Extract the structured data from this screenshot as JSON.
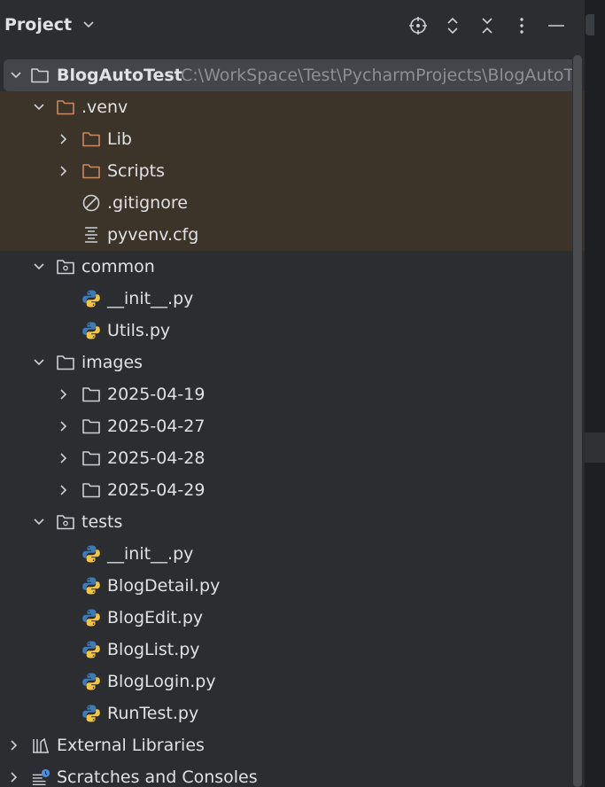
{
  "header": {
    "title": "Project",
    "buttons": [
      "locate-icon",
      "expand-all-icon",
      "collapse-all-icon",
      "more-icon",
      "minimize-icon"
    ]
  },
  "tree": {
    "root": {
      "label": "BlogAutoTest",
      "path": "C:\\WorkSpace\\Test\\PycharmProjects\\BlogAutoTest"
    },
    "venv": {
      "label": ".venv"
    },
    "lib": {
      "label": "Lib"
    },
    "scripts": {
      "label": "Scripts"
    },
    "gitignore": {
      "label": ".gitignore"
    },
    "pyvenv": {
      "label": "pyvenv.cfg"
    },
    "common": {
      "label": "common"
    },
    "common_init": {
      "label": "__init__.py"
    },
    "utils": {
      "label": "Utils.py"
    },
    "images": {
      "label": "images"
    },
    "img_dirs": [
      "2025-04-19",
      "2025-04-27",
      "2025-04-28",
      "2025-04-29"
    ],
    "tests": {
      "label": "tests"
    },
    "test_files": [
      "__init__.py",
      "BlogDetail.py",
      "BlogEdit.py",
      "BlogList.py",
      "BlogLogin.py",
      "RunTest.py"
    ],
    "external_libraries": {
      "label": "External Libraries"
    },
    "scratches": {
      "label": "Scratches and Consoles"
    }
  },
  "colors": {
    "background": "#2b2d30",
    "excluded_highlight": "#3d3429",
    "selected_row": "#43454a",
    "folder_excluded": "#c88a62",
    "folder_normal": "#ced0d6",
    "path_text": "#8c8f94",
    "python_blue": "#3d7ab8",
    "python_yellow": "#f4c542"
  }
}
